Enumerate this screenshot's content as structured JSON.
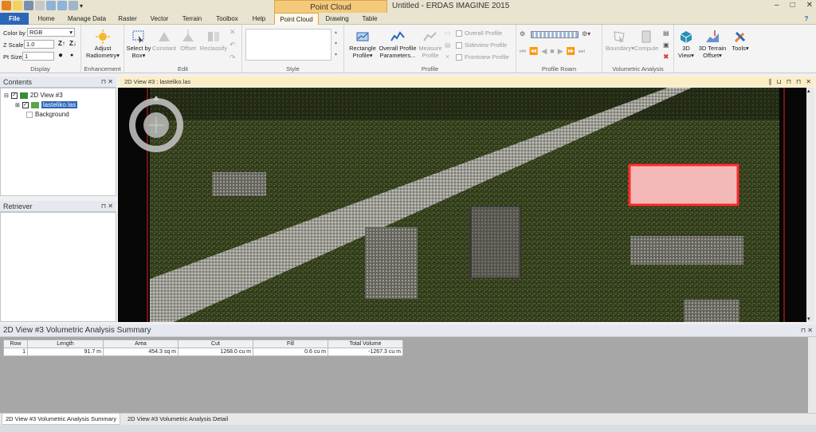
{
  "app": {
    "title": "Untitled - ERDAS IMAGINE 2015",
    "context_tab_group": "Point Cloud",
    "window_controls": [
      "–",
      "□",
      "✕"
    ],
    "help_symbol": "?"
  },
  "tabs": [
    "File",
    "Home",
    "Manage Data",
    "Raster",
    "Vector",
    "Terrain",
    "Toolbox",
    "Help",
    "Point Cloud",
    "Drawing",
    "Table"
  ],
  "ribbon": {
    "display": {
      "color_by_label": "Color by",
      "color_by_value": "RGB",
      "z_scale_label": "Z Scale",
      "z_scale_value": "1.0",
      "pt_size_label": "Pt Size",
      "pt_size_value": "1",
      "group_label": "Display"
    },
    "enhancement": {
      "adjust_radiometry": "Adjust Radiometry",
      "group_label": "Enhancement"
    },
    "edit": {
      "select_by_box": "Select by Box",
      "constant": "Constant",
      "offset": "Offset",
      "reclassify": "Reclassify",
      "group_label": "Edit"
    },
    "style": {
      "group_label": "Style"
    },
    "profile": {
      "rectangle_profile": "Rectangle Profile",
      "overall_profile_parameters": "Overall Profile Parameters...",
      "measure_profile": "Measure Profile",
      "overall_profile": "Overall Profile",
      "sideview_profile": "Sideview Profile",
      "frontview_profile": "Frontview Profile",
      "group_label": "Profile"
    },
    "profile_roam": {
      "group_label": "Profile Roam"
    },
    "volumetric": {
      "boundary": "Boundary",
      "compute": "Compute",
      "group_label": "Volumetric Analysis"
    },
    "view3d": {
      "view_3d": "3D View",
      "terrain_offset": "3D Terrain Offset",
      "tools": "Tools"
    }
  },
  "contents": {
    "title": "Contents",
    "tree": [
      {
        "label": "2D View #3",
        "checked": true
      },
      {
        "label": "lasteliko.las",
        "checked": true,
        "selected": true
      },
      {
        "label": "Background",
        "checked": false
      }
    ]
  },
  "retriever": {
    "title": "Retriever"
  },
  "panel_buttons": {
    "pin": "⊓",
    "close": "✕"
  },
  "view": {
    "title": "2D View #3 : lasteliko.las"
  },
  "summary": {
    "title": "2D View #3 Volumetric Analysis Summary",
    "columns": [
      "Row",
      "Length",
      "Area",
      "Cut",
      "Fill",
      "Total Volume"
    ],
    "rows": [
      [
        "1",
        "91.7 m",
        "454.3 sq m",
        "1268.0 cu m",
        "0.6 cu m",
        "-1267.3 cu m"
      ]
    ]
  },
  "bottom_tabs": [
    "2D View #3 Volumetric Analysis Summary",
    "2D View #3 Volumetric Analysis Detail"
  ],
  "colors": {
    "accent": "#2c66b8",
    "context_tab": "#f5c97a",
    "selection": "#ff3b3b",
    "view_header": "#fbeec7"
  }
}
